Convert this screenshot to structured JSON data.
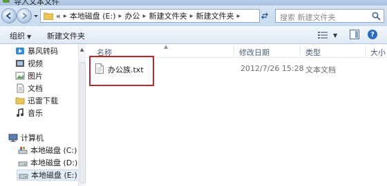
{
  "window": {
    "title": "导入文本文件"
  },
  "address": {
    "prefix": "«",
    "crumbs": [
      "本地磁盘 (E:)",
      "办公",
      "新建文件夹",
      "新建文件夹"
    ],
    "search_placeholder": "搜索 新建文件夹"
  },
  "toolbar": {
    "organize": "组织",
    "new_folder": "新建文件夹"
  },
  "nav": {
    "favorites": [
      {
        "label": "暴风转码",
        "icon": "video-app-icon"
      },
      {
        "label": "视频",
        "icon": "video-library-icon"
      },
      {
        "label": "图片",
        "icon": "picture-library-icon"
      },
      {
        "label": "文档",
        "icon": "document-library-icon"
      },
      {
        "label": "迅雷下载",
        "icon": "download-folder-icon"
      },
      {
        "label": "音乐",
        "icon": "music-library-icon"
      }
    ],
    "computer": "计算机",
    "drives": [
      {
        "label": "本地磁盘 (C:)",
        "selected": false
      },
      {
        "label": "本地磁盘 (D:)",
        "selected": false
      },
      {
        "label": "本地磁盘 (E:)",
        "selected": true
      }
    ]
  },
  "columns": {
    "name": "名称",
    "modified": "修改日期",
    "type": "类型",
    "size": "大小"
  },
  "files": [
    {
      "name": "办公族.txt",
      "modified": "2012/7/26 15:28",
      "type": "文本文档"
    }
  ],
  "colors": {
    "highlight_border": "#b52a2a",
    "header_text": "#4c607a"
  }
}
